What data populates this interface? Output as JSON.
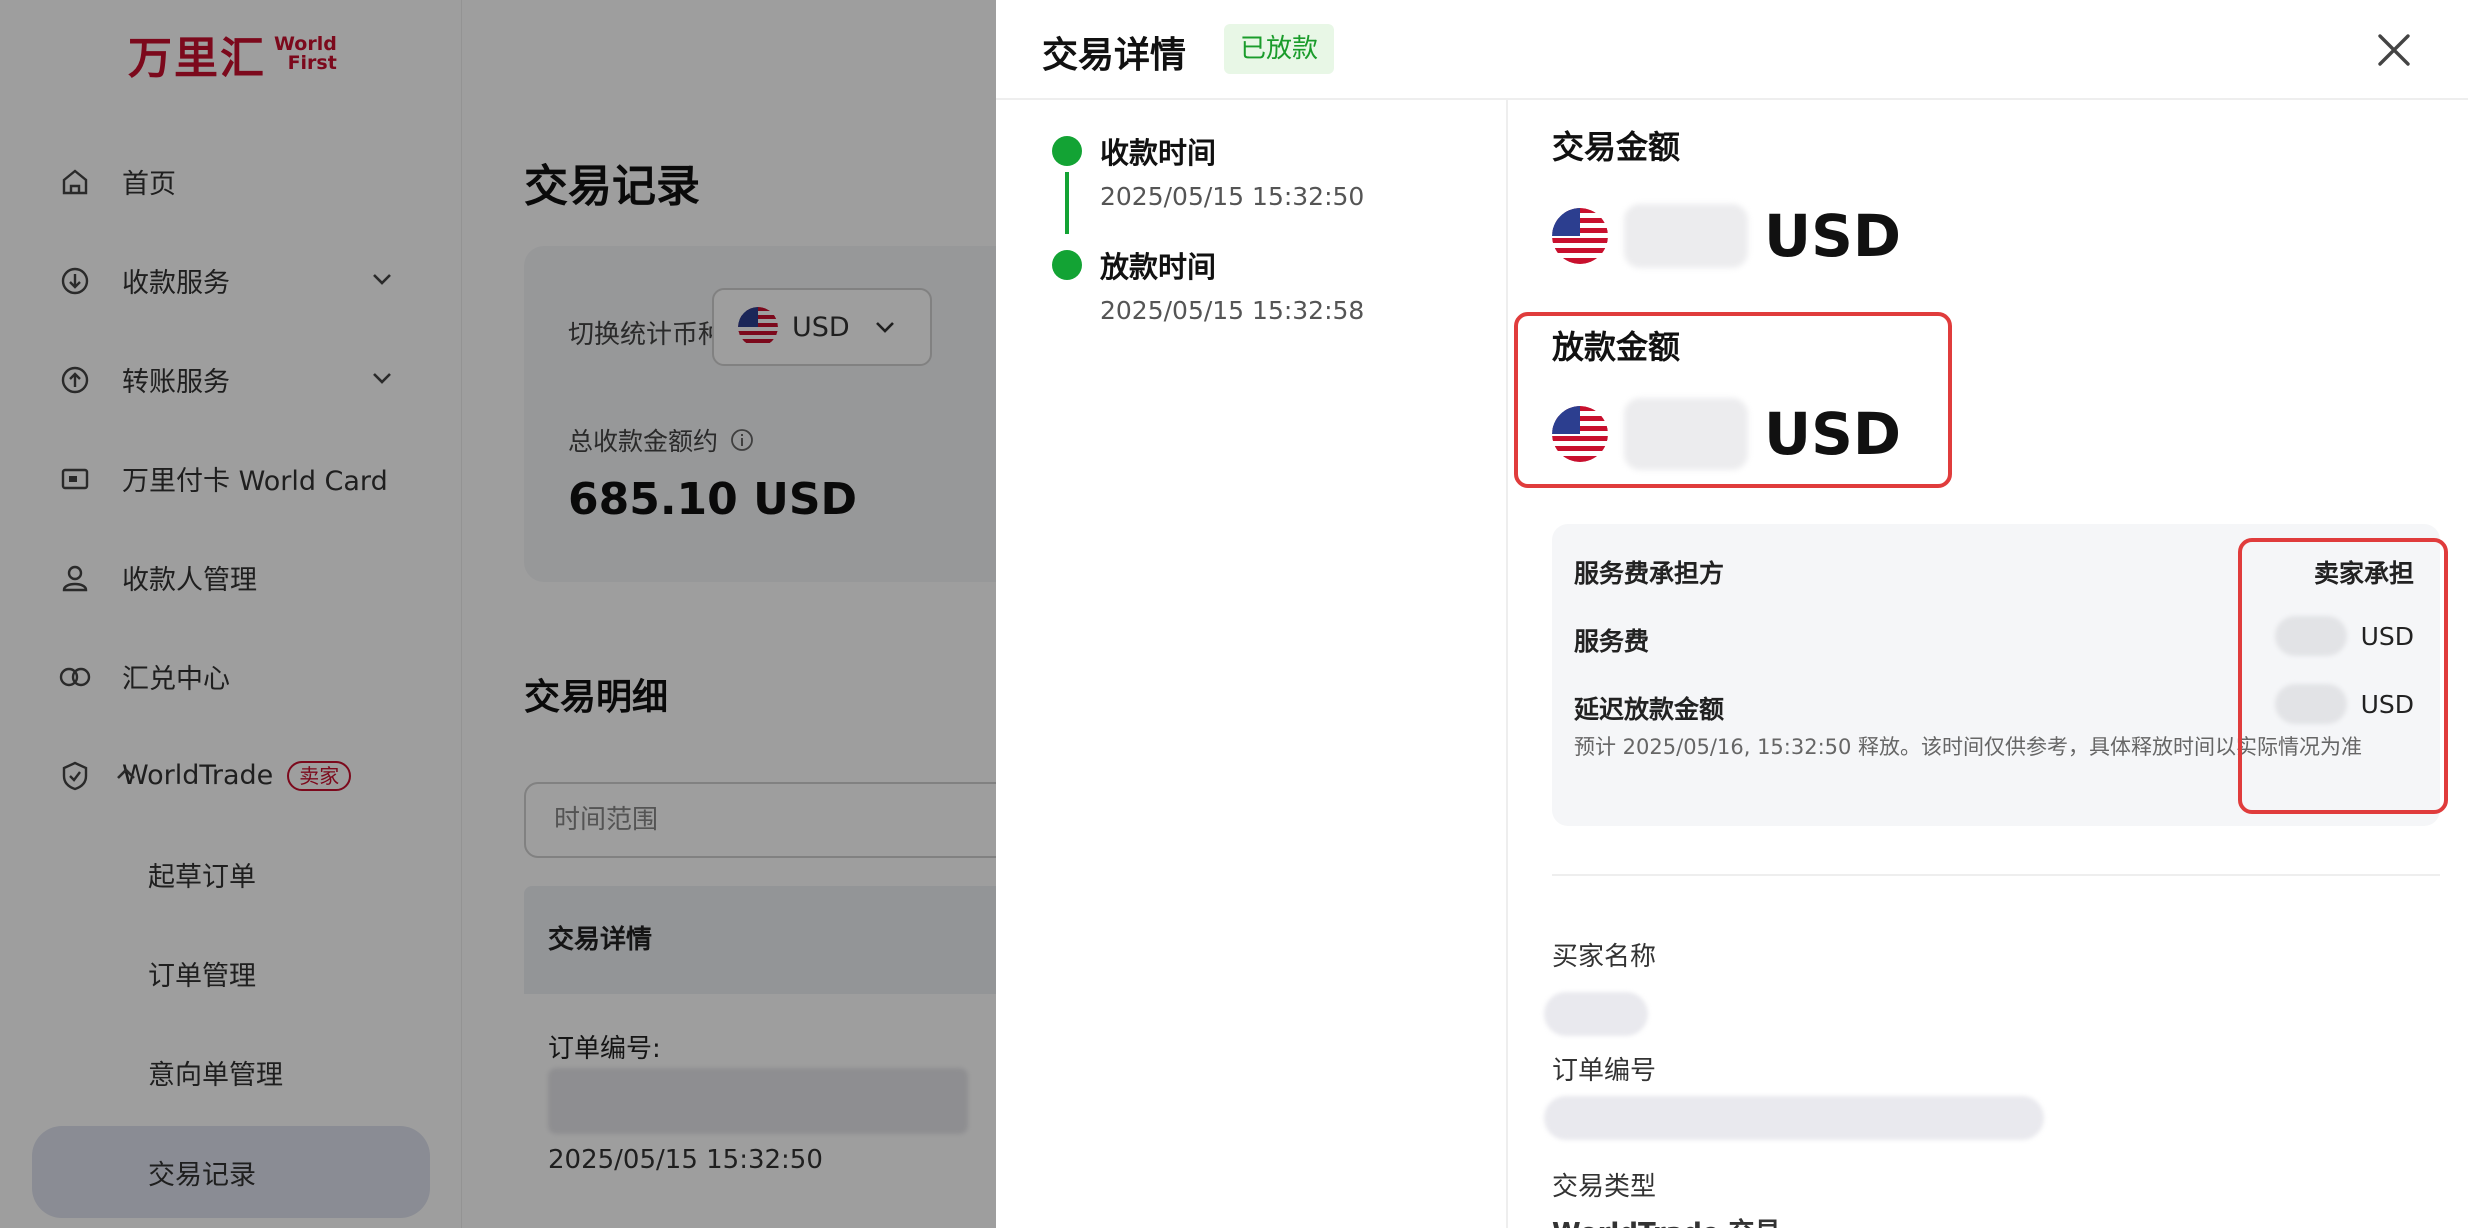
{
  "brand": {
    "logo_cn": "万里汇",
    "logo_en_line1": "World",
    "logo_en_line2": "First"
  },
  "sidebar": {
    "items": [
      {
        "label": "首页"
      },
      {
        "label": "收款服务"
      },
      {
        "label": "转账服务"
      },
      {
        "label": "万里付卡 World Card"
      },
      {
        "label": "收款人管理"
      },
      {
        "label": "汇兑中心"
      },
      {
        "label": "WorldTrade",
        "badge": "卖家"
      }
    ],
    "sub_items": [
      {
        "label": "起草订单"
      },
      {
        "label": "订单管理"
      },
      {
        "label": "意向单管理"
      },
      {
        "label": "交易记录"
      }
    ]
  },
  "main": {
    "title": "交易记录",
    "stats": {
      "switch_label": "切换统计币种",
      "currency": "USD",
      "total_label": "总收款金额约",
      "total_value": "685.10 USD"
    },
    "detail_title": "交易明细",
    "range_placeholder": "时间范围",
    "table_header": "交易详情",
    "order_no_label": "订单编号:",
    "order_date": "2025/05/15 15:32:50"
  },
  "drawer": {
    "title": "交易详情",
    "status": "已放款",
    "timeline": [
      {
        "label": "收款时间",
        "time": "2025/05/15 15:32:50"
      },
      {
        "label": "放款时间",
        "time": "2025/05/15 15:32:58"
      }
    ],
    "trade_amount_label": "交易金额",
    "trade_amount_currency": "USD",
    "release_amount_label": "放款金额",
    "release_amount_currency": "USD",
    "fees": {
      "bearer_label": "服务费承担方",
      "bearer_value": "卖家承担",
      "fee_label": "服务费",
      "fee_currency": "USD",
      "delay_label": "延迟放款金额",
      "delay_currency": "USD",
      "delay_note": "预计 2025/05/16, 15:32:50 释放。该时间仅供参考，具体释放时间以实际情况为准"
    },
    "buyer_label": "买家名称",
    "order_no_label": "订单编号",
    "trade_type_label": "交易类型",
    "trade_type_partial": "WorldTrade 交易"
  },
  "colors": {
    "brand_red": "#c8102e",
    "status_green": "#13a334",
    "highlight_red": "#e03c3c"
  }
}
